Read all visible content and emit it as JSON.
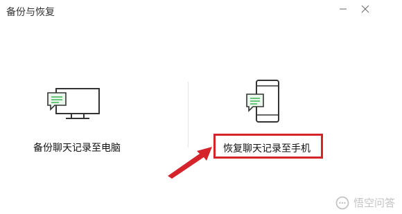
{
  "window": {
    "title": "备份与恢复"
  },
  "options": {
    "backup_to_pc": {
      "label": "备份聊天记录至电脑",
      "icon": "monitor-chat-icon"
    },
    "restore_to_phone": {
      "label": "恢复聊天记录至手机",
      "icon": "phone-chat-icon"
    }
  },
  "annotation": {
    "highlight_color": "#d4232b"
  },
  "watermark": {
    "text": "悟空问答",
    "icon": "chat-bubble-icon"
  }
}
